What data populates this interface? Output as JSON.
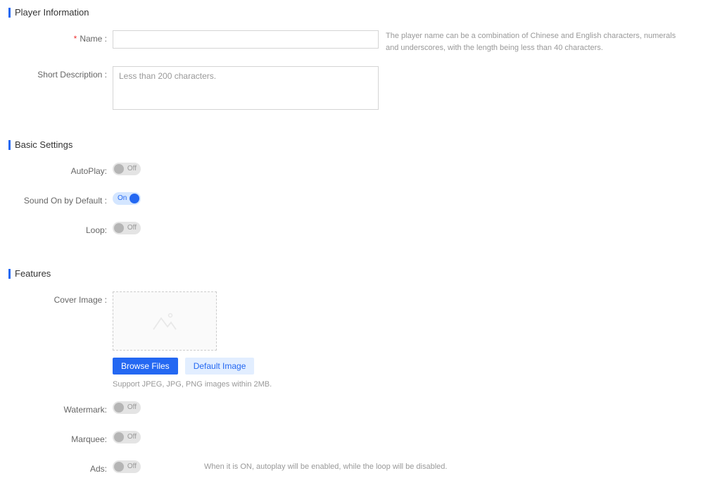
{
  "sections": {
    "player_info": "Player Information",
    "basic_settings": "Basic Settings",
    "features": "Features"
  },
  "labels": {
    "name": "Name :",
    "short_desc": "Short Description :",
    "autoplay": "AutoPlay:",
    "sound_on": "Sound On by Default :",
    "loop": "Loop:",
    "cover_image": "Cover Image :",
    "watermark": "Watermark:",
    "marquee": "Marquee:",
    "ads": "Ads:"
  },
  "placeholders": {
    "short_desc": "Less than 200 characters."
  },
  "hints": {
    "name": "The player name can be a combination of Chinese and English characters, numerals and underscores, with the length being less than 40 characters.",
    "support": "Support JPEG, JPG, PNG images within 2MB.",
    "ads": "When it is ON, autoplay will be enabled, while the loop will be disabled."
  },
  "toggle": {
    "off": "Off",
    "on": "On"
  },
  "buttons": {
    "browse": "Browse Files",
    "default_img": "Default Image"
  },
  "values": {
    "name": "",
    "short_desc": ""
  }
}
